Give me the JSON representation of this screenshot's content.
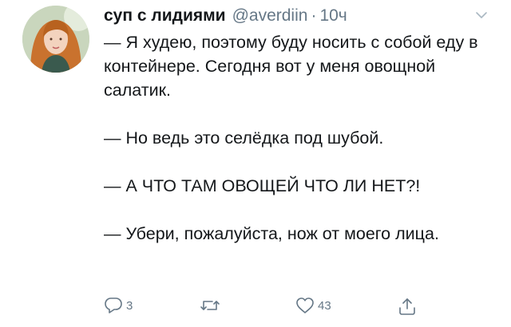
{
  "tweet": {
    "display_name": "суп с лидиями",
    "handle": "@averdiin",
    "separator": "·",
    "time": "10ч",
    "paragraphs": [
      "— Я худею, поэтому буду носить с собой еду в контейнере. Сегодня вот у меня овощной салатик.",
      "— Но ведь это селёдка под шубой.",
      "— А ЧТО ТАМ ОВОЩЕЙ ЧТО ЛИ НЕТ?!",
      "— Убери, пожалуйста, нож от моего лица."
    ]
  },
  "actions": {
    "reply_count": "3",
    "retweet_count": "",
    "like_count": "43"
  },
  "icons": {
    "reply": "reply-icon",
    "retweet": "retweet-icon",
    "like": "heart-icon",
    "share": "share-icon",
    "menu": "chevron-down-icon"
  },
  "colors": {
    "text": "#14171a",
    "secondary": "#657786"
  }
}
